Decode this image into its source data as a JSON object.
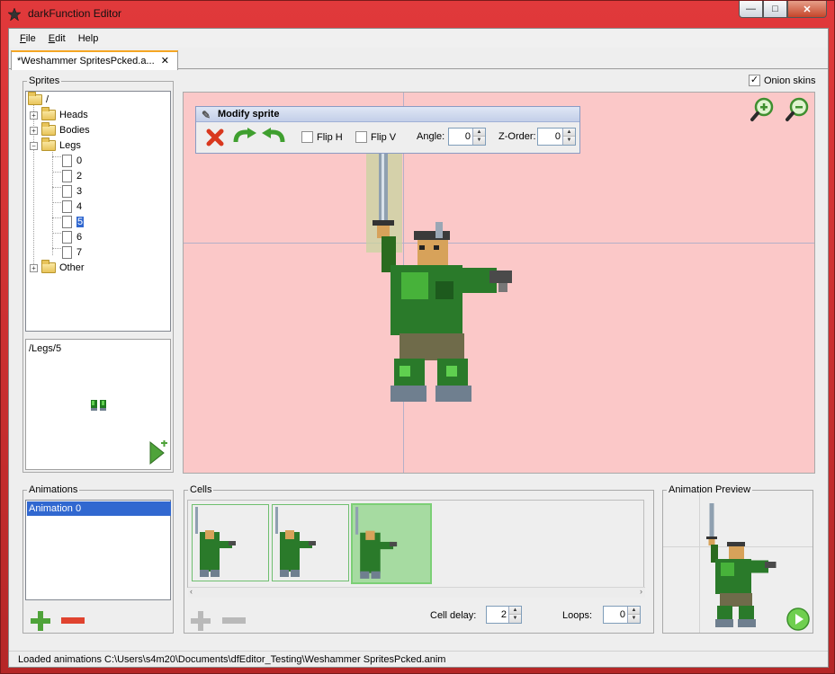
{
  "window": {
    "title": "darkFunction Editor",
    "minimize_glyph": "—",
    "maximize_glyph": "□",
    "close_glyph": "✕"
  },
  "menu": [
    {
      "label": "File",
      "mnemonic": "F",
      "rest": "ile"
    },
    {
      "label": "Edit",
      "mnemonic": "E",
      "rest": "dit"
    },
    {
      "label": "Help",
      "mnemonic": "",
      "rest": "Help"
    }
  ],
  "document_tab": {
    "label": "*Weshammer SpritesPcked.a...",
    "close_glyph": "✕"
  },
  "sprites": {
    "title": "Sprites",
    "tree": [
      {
        "label": "/",
        "kind": "folder",
        "depth": 0
      },
      {
        "label": "Heads",
        "kind": "folder",
        "depth": 1,
        "expander": "+"
      },
      {
        "label": "Bodies",
        "kind": "folder",
        "depth": 1,
        "expander": "+"
      },
      {
        "label": "Legs",
        "kind": "folder",
        "depth": 1,
        "expander": "−"
      },
      {
        "label": "0",
        "kind": "file",
        "depth": 2
      },
      {
        "label": "2",
        "kind": "file",
        "depth": 2
      },
      {
        "label": "3",
        "kind": "file",
        "depth": 2
      },
      {
        "label": "4",
        "kind": "file",
        "depth": 2
      },
      {
        "label": "5",
        "kind": "file",
        "depth": 2,
        "selected": true
      },
      {
        "label": "6",
        "kind": "file",
        "depth": 2
      },
      {
        "label": "7",
        "kind": "file",
        "depth": 2
      },
      {
        "label": "Other",
        "kind": "folder",
        "depth": 1,
        "expander": "+"
      }
    ],
    "preview_path": "/Legs/5"
  },
  "onion_skins": {
    "label": "Onion skins",
    "checked": true
  },
  "modify_sprite": {
    "title": "Modify sprite",
    "flip_h": "Flip H",
    "flip_v": "Flip V",
    "angle_label": "Angle:",
    "angle_value": "0",
    "zorder_label": "Z-Order:",
    "zorder_value": "0"
  },
  "animations": {
    "title": "Animations",
    "items": [
      "Animation 0"
    ],
    "selected_index": 0
  },
  "cells": {
    "title": "Cells",
    "count": 3,
    "selected_index": 2,
    "cell_delay_label": "Cell delay:",
    "cell_delay_value": "2",
    "loops_label": "Loops:",
    "loops_value": "0"
  },
  "animation_preview": {
    "title": "Animation Preview"
  },
  "status": {
    "text": "Loaded animations C:\\Users\\s4m20\\Documents\\dfEditor_Testing\\Weshammer SpritesPcked.anim"
  },
  "colors": {
    "canvas_bg": "#fbc8c8",
    "selection": "#3168d0",
    "cell_selected": "#a6dba1",
    "add_icon": "#4fa33a",
    "remove_icon": "#e0432f"
  }
}
